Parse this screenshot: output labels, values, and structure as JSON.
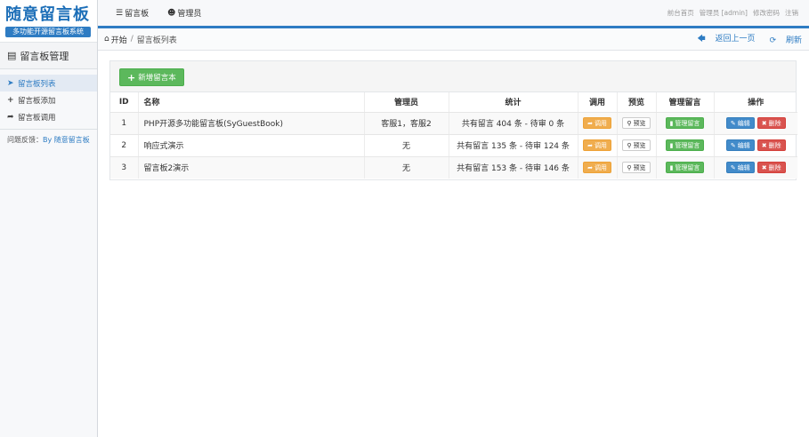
{
  "logo": {
    "title": "随意留言板",
    "subtitle": "多功能开源留言板系统"
  },
  "sidebar": {
    "header": "留言板管理",
    "items": [
      {
        "label": "留言板列表",
        "icon": "arrow-circle-icon"
      },
      {
        "label": "留言板添加",
        "icon": "plus-icon"
      },
      {
        "label": "留言板调用",
        "icon": "share-arrow-icon"
      }
    ],
    "feedback_label": "问题反馈：",
    "feedback_link": "By 随意留言板"
  },
  "topnav": {
    "items": [
      {
        "label": "留言板",
        "icon": "list-icon"
      },
      {
        "label": "管理员",
        "icon": "user-icon"
      }
    ],
    "right": [
      "前台首页",
      "管理员 [admin]",
      "修改密码",
      "注销"
    ]
  },
  "breadcrumb": {
    "home": "开始",
    "current": "留言板列表",
    "back": "返回上一页",
    "refresh": "刷新"
  },
  "panel": {
    "add_button": "新增留言本",
    "columns": [
      "ID",
      "名称",
      "管理员",
      "统计",
      "调用",
      "预览",
      "管理留言",
      "操作"
    ],
    "rows": [
      {
        "id": "1",
        "name": "PHP开源多功能留言板(SyGuestBook)",
        "admin": "客服1，客服2",
        "stats": "共有留言 404 条 - 待审 0 条"
      },
      {
        "id": "2",
        "name": "响应式演示",
        "admin": "无",
        "stats": "共有留言 135 条 - 待审 124 条"
      },
      {
        "id": "3",
        "name": "留言板2演示",
        "admin": "无",
        "stats": "共有留言 153 条 - 待审 146 条"
      }
    ],
    "btn_call": "调用",
    "btn_preview": "预览",
    "btn_manage": "管理留言",
    "btn_edit": "编辑",
    "btn_delete": "删除"
  },
  "colors": {
    "accent": "#2e7cc3",
    "green": "#5cb85c",
    "orange": "#f0ad4e",
    "blue": "#428bca",
    "red": "#d9534f"
  }
}
